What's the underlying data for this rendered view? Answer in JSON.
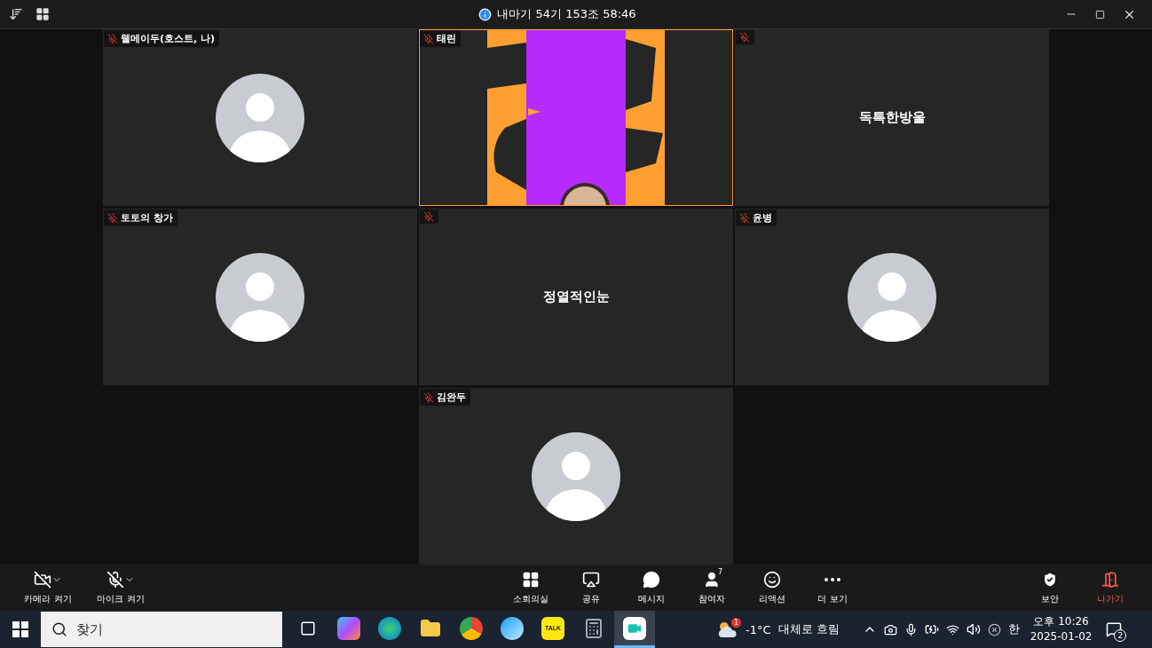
{
  "window": {
    "title": "내마기 54기 153조 58:46"
  },
  "tiles": [
    {
      "name": "웰메이두(호스트, 나)",
      "muted": true,
      "kind": "avatar",
      "speaking": false
    },
    {
      "name": "태린",
      "muted": true,
      "kind": "video",
      "speaking": true
    },
    {
      "muted": true,
      "kind": "name",
      "display_name": "독특한방울",
      "speaking": false
    },
    {
      "name": "토토의 창가",
      "muted": true,
      "kind": "avatar",
      "speaking": false
    },
    {
      "muted": true,
      "kind": "name",
      "display_name": "정열적인눈",
      "speaking": false
    },
    {
      "name": "윤병",
      "muted": true,
      "kind": "avatar",
      "speaking": false
    },
    {
      "name": "김완두",
      "muted": true,
      "kind": "avatar",
      "speaking": false
    }
  ],
  "toolbar": {
    "left": [
      {
        "kind": "camera",
        "label": "카메라 켜기"
      },
      {
        "kind": "mic",
        "label": "마이크 켜기"
      }
    ],
    "center": [
      {
        "kind": "breakout",
        "label": "소회의실"
      },
      {
        "kind": "share",
        "label": "공유"
      },
      {
        "kind": "chat",
        "label": "메시지"
      },
      {
        "kind": "participants",
        "label": "참여자",
        "badge": "7"
      },
      {
        "kind": "reactions",
        "label": "리액션"
      },
      {
        "kind": "more",
        "label": "더 보기"
      }
    ],
    "right": [
      {
        "kind": "security",
        "label": "보안"
      },
      {
        "kind": "leave",
        "label": "나가기"
      }
    ]
  },
  "taskbar": {
    "search_placeholder": "찾기",
    "apps": [
      {
        "kind": "taskview",
        "active": false
      },
      {
        "kind": "copilot",
        "active": false
      },
      {
        "kind": "edge",
        "active": false
      },
      {
        "kind": "explorer",
        "active": false
      },
      {
        "kind": "chrome",
        "active": false
      },
      {
        "kind": "whale",
        "active": false
      },
      {
        "kind": "kakao",
        "label": "TALK",
        "active": false
      },
      {
        "kind": "calculator",
        "active": false
      },
      {
        "kind": "zoom",
        "active": true
      }
    ],
    "weather": {
      "badge": "1",
      "temperature": "-1°C",
      "condition": "대체로 흐림"
    },
    "ime": "한",
    "time": "오후 10:26",
    "date": "2025-01-02",
    "notifications": "2"
  }
}
